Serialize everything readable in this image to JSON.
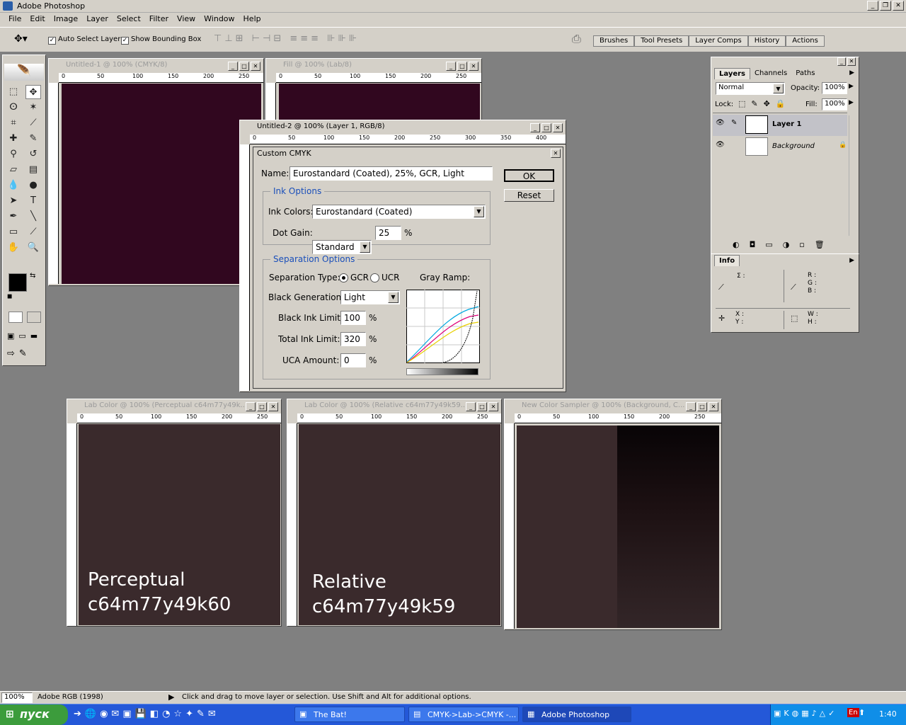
{
  "app": {
    "title": "Adobe Photoshop"
  },
  "menu": [
    "File",
    "Edit",
    "Image",
    "Layer",
    "Select",
    "Filter",
    "View",
    "Window",
    "Help"
  ],
  "options": {
    "auto_select": "Auto Select Layer",
    "show_bbox": "Show Bounding Box"
  },
  "palette_well": [
    "Brushes",
    "Tool Presets",
    "Layer Comps",
    "History",
    "Actions"
  ],
  "docs": {
    "untitled1": {
      "title": "Untitled-1 @ 100% (CMYK/8)"
    },
    "fill": {
      "title": "Fill @ 100% (Lab/8)"
    },
    "untitled2": {
      "title": "Untitled-2 @ 100% (Layer 1, RGB/8)"
    },
    "perceptual": {
      "title": "Lab Color @ 100% (Perceptual c64m77y49k...",
      "line1": "Perceptual",
      "line2": "c64m77y49k60"
    },
    "relative": {
      "title": "Lab Color @ 100% (Relative c64m77y49k59...",
      "line1": "Relative",
      "line2": "c64m77y49k59"
    },
    "sampler": {
      "title": "New Color Sampler @ 100% (Background, C..."
    }
  },
  "ruler_h_small": [
    "0",
    "50",
    "100",
    "150",
    "200",
    "250"
  ],
  "ruler_h_large": [
    "0",
    "50",
    "100",
    "150",
    "200",
    "250",
    "300",
    "350",
    "400"
  ],
  "dialog": {
    "title": "Custom CMYK",
    "name_label": "Name:",
    "name_value": "Eurostandard (Coated), 25%, GCR, Light",
    "ok": "OK",
    "reset": "Reset",
    "ink_options": "Ink Options",
    "ink_colors_label": "Ink Colors:",
    "ink_colors_value": "Eurostandard (Coated)",
    "dot_gain_label": "Dot Gain:",
    "dot_gain_mode": "Standard",
    "dot_gain_value": "25",
    "percent": "%",
    "separation_options": "Separation Options",
    "sep_type_label": "Separation Type:",
    "gcr": "GCR",
    "ucr": "UCR",
    "gray_ramp": "Gray Ramp:",
    "black_gen_label": "Black Generation:",
    "black_gen_value": "Light",
    "black_ink_label": "Black Ink Limit:",
    "black_ink_value": "100",
    "total_ink_label": "Total Ink Limit:",
    "total_ink_value": "320",
    "uca_label": "UCA Amount:",
    "uca_value": "0"
  },
  "layers_panel": {
    "tabs": [
      "Layers",
      "Channels",
      "Paths"
    ],
    "blend_mode": "Normal",
    "opacity_label": "Opacity:",
    "opacity_value": "100%",
    "lock_label": "Lock:",
    "fill_label": "Fill:",
    "fill_value": "100%",
    "layers": [
      {
        "name": "Layer 1"
      },
      {
        "name": "Background"
      }
    ]
  },
  "info_panel": {
    "tab": "Info",
    "r": "R :",
    "g": "G :",
    "b": "B :",
    "x": "X :",
    "y": "Y :",
    "w": "W :",
    "h": "H :",
    "sigma": "Σ :"
  },
  "status": {
    "zoom": "100%",
    "profile": "Adobe RGB (1998)",
    "hint": "Click and drag to move layer or selection.  Use Shift and Alt for additional options."
  },
  "taskbar": {
    "start": "пуск",
    "items": [
      "The Bat!",
      "CMYK->Lab->CMYK -...",
      "Adobe Photoshop"
    ],
    "lang": "En",
    "time": "1:40"
  },
  "colors": {
    "cmyk_canvas": "#31071f",
    "lab_canvas": "#3a2a2c"
  }
}
